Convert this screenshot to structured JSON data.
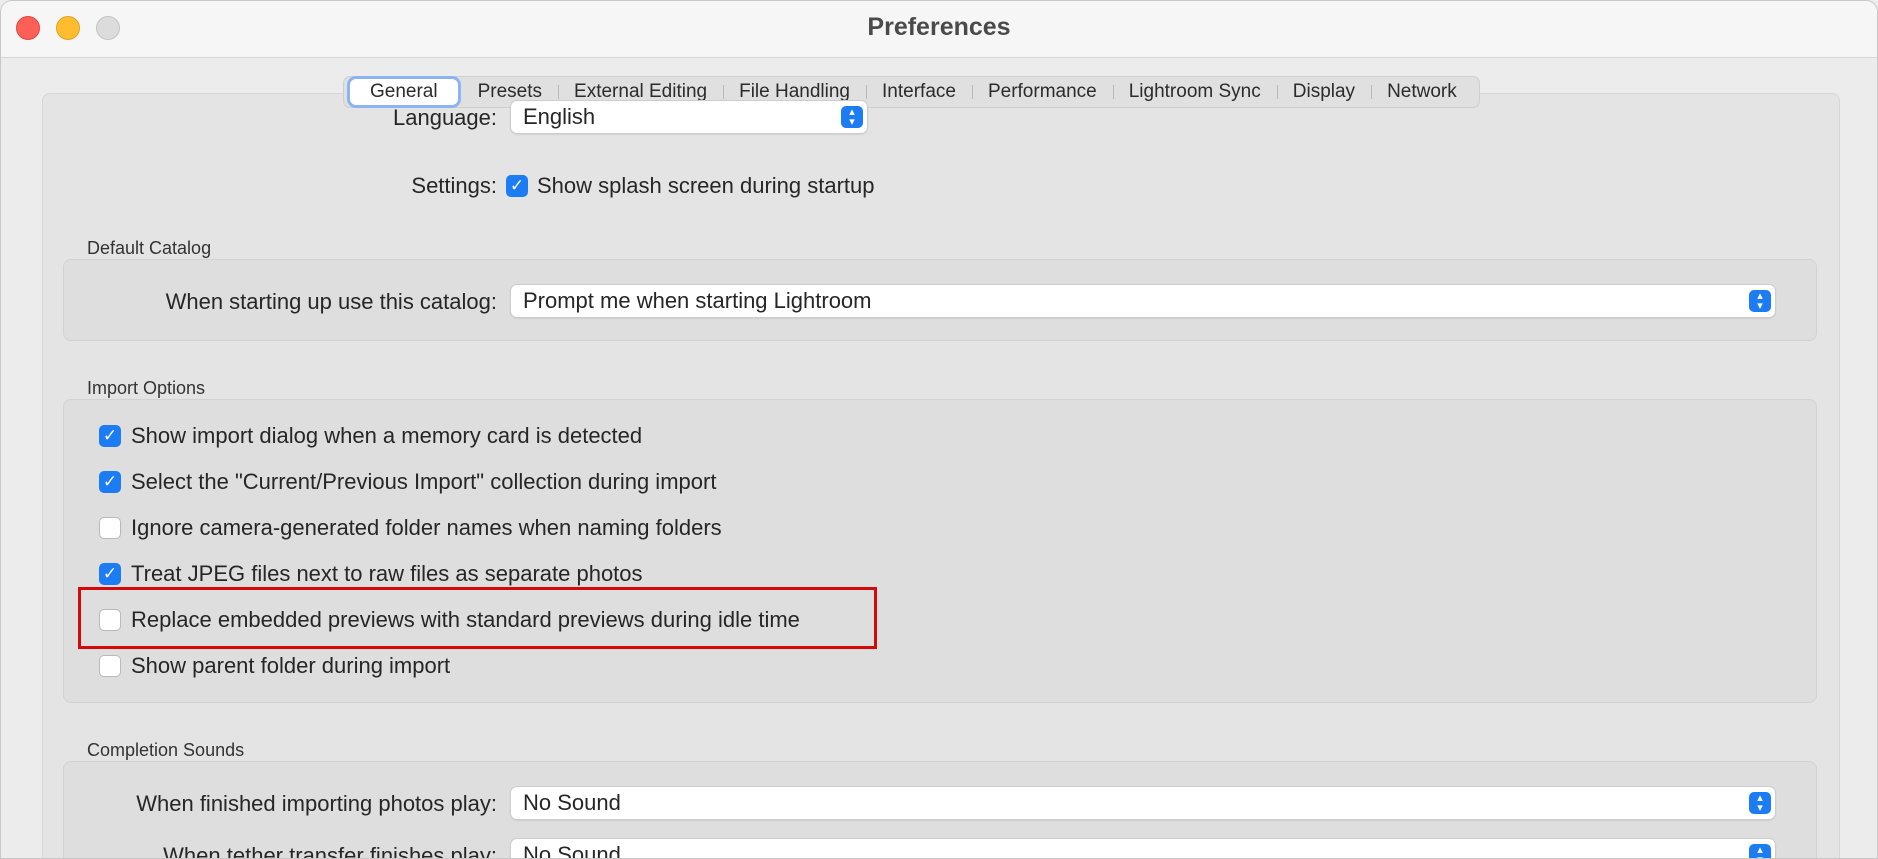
{
  "window": {
    "title": "Preferences"
  },
  "tabs": [
    "General",
    "Presets",
    "External Editing",
    "File Handling",
    "Interface",
    "Performance",
    "Lightroom Sync",
    "Display",
    "Network"
  ],
  "general": {
    "language_label": "Language:",
    "language_value": "English",
    "settings_label": "Settings:",
    "splash_label": "Show splash screen during startup",
    "splash_checked": true
  },
  "default_catalog": {
    "title": "Default Catalog",
    "label": "When starting up use this catalog:",
    "value": "Prompt me when starting Lightroom"
  },
  "import_options": {
    "title": "Import Options",
    "items": [
      {
        "label": "Show import dialog when a memory card is detected",
        "checked": true
      },
      {
        "label": "Select the \"Current/Previous Import\" collection during import",
        "checked": true
      },
      {
        "label": "Ignore camera-generated folder names when naming folders",
        "checked": false
      },
      {
        "label": "Treat JPEG files next to raw files as separate photos",
        "checked": true
      },
      {
        "label": "Replace embedded previews with standard previews during idle time",
        "checked": false
      },
      {
        "label": "Show parent folder during import",
        "checked": false
      }
    ]
  },
  "completion_sounds": {
    "title": "Completion Sounds",
    "import_label": "When finished importing photos play:",
    "import_value": "No Sound",
    "tether_label": "When tether transfer finishes play:",
    "tether_value": "No Sound"
  },
  "colors": {
    "accent": "#1c7cf4",
    "highlight": "#d40a0a"
  }
}
